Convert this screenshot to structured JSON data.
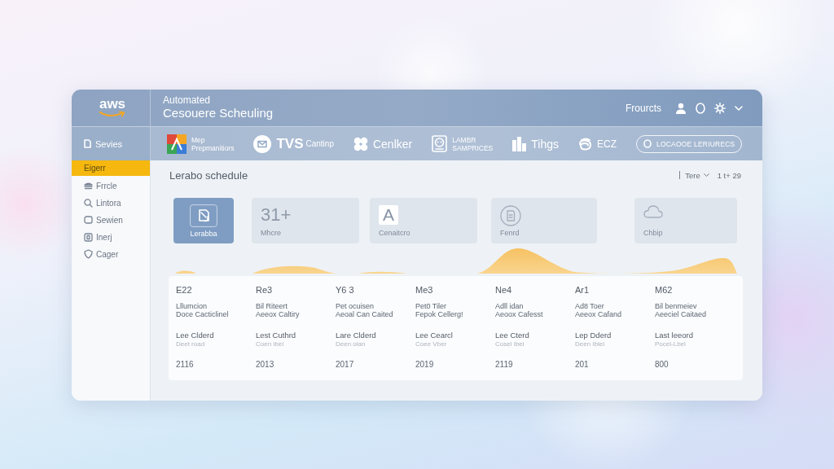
{
  "header": {
    "logo": "aws",
    "subtitle": "Automated",
    "title": "Cesouere Scheuling",
    "link": "Frourcts"
  },
  "services": [
    {
      "kind": "stacked",
      "label": "Mep",
      "sub": "Prepmanitiors"
    },
    {
      "kind": "split",
      "label": "TVS",
      "sub": "Cantinp"
    },
    {
      "kind": "plain",
      "label": "Cenlker"
    },
    {
      "kind": "stacked",
      "label": "LAMBR",
      "sub": "SAMPRICES"
    },
    {
      "kind": "plain",
      "label": "Tihgs"
    },
    {
      "kind": "small",
      "label": "ECZ"
    },
    {
      "kind": "pill",
      "label": "LOCAOOE LERIURECS"
    }
  ],
  "sidebar": {
    "heading": "Sevies",
    "items": [
      {
        "label": "Eigerr",
        "selected": true
      },
      {
        "label": "Frrcle",
        "selected": false
      },
      {
        "label": "Lintora",
        "selected": false
      },
      {
        "label": "Sewien",
        "selected": false
      },
      {
        "label": "Inerj",
        "selected": false
      },
      {
        "label": "Cager",
        "selected": false
      }
    ]
  },
  "main": {
    "title": "Lerabo schedule",
    "filter": "Tere",
    "range": "1 t+ 29"
  },
  "cards": [
    {
      "kind": "icon",
      "label": "Lerabba",
      "selected": true
    },
    {
      "kind": "value",
      "value": "31+",
      "label": "Mhcre",
      "selected": false
    },
    {
      "kind": "glyph",
      "glyph": "A",
      "label": "Cenaitcro",
      "selected": false
    },
    {
      "kind": "icon",
      "label": "Fenrd",
      "selected": false
    },
    {
      "kind": "icon",
      "label": "Chbip",
      "selected": false
    }
  ],
  "table": {
    "columns": [
      {
        "code": "E22",
        "description": "Lllumcion\nDoce Cacticlinel",
        "status": "Lee Clderd",
        "note": "Deet road",
        "year": "2116"
      },
      {
        "code": "Re3",
        "description": "Bil Riteert\nAeeox Caltiry",
        "status": "Lest Cuthrd",
        "note": "Coen Ibel",
        "year": "2013"
      },
      {
        "code": "Y6 3",
        "description": "Pet ocuisen\nAeoal Can Caited",
        "status": "Lare Clderd",
        "note": "Deen olan",
        "year": "2017"
      },
      {
        "code": "Me3",
        "description": "Pet0 Tiler\nFepok Cellerg!",
        "status": "Lee Cearcl",
        "note": "Coee Vber",
        "year": "2019"
      },
      {
        "code": "Ne4",
        "description": "Adll idan\nAeoox Cafesst",
        "status": "Lee Cterd",
        "note": "Cosel Ibel",
        "year": "2119"
      },
      {
        "code": "Ar1",
        "description": "Ad8 Toer\nAeeox Cafand",
        "status": "Lep Dderd",
        "note": "Deen Iblel",
        "year": "201"
      },
      {
        "code": "M62",
        "description": "Bil benmeiev\nAeeciel Caitaed",
        "status": "Last leeord",
        "note": "Pocel-Lbel",
        "year": "800"
      }
    ]
  }
}
